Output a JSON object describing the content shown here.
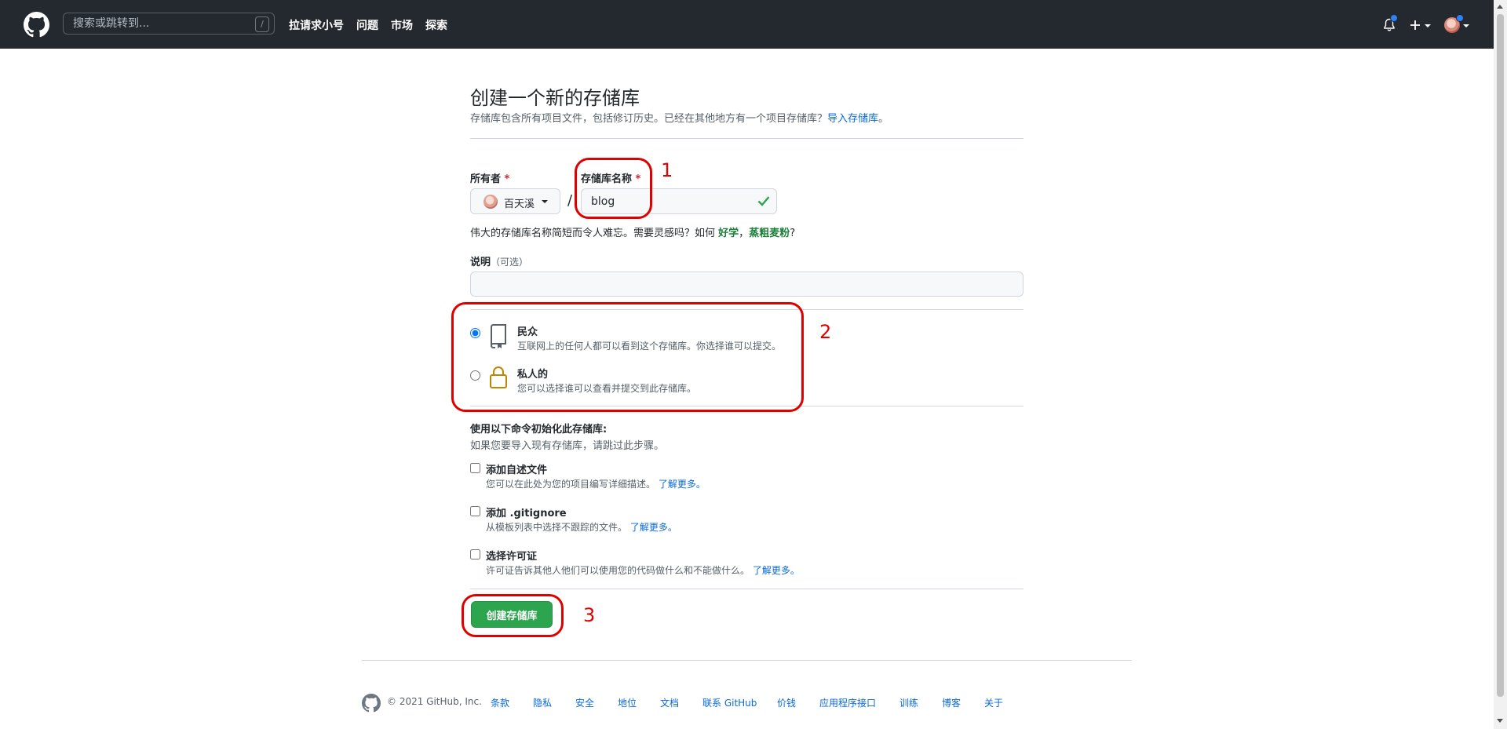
{
  "header": {
    "search_placeholder": "搜索或跳转到...",
    "search_shortcut": "/",
    "nav": [
      "拉请求小号",
      "问题",
      "市场",
      "探索"
    ],
    "icons": [
      "github-mark-icon",
      "bell-icon",
      "plus-icon",
      "avatar"
    ]
  },
  "page": {
    "title": "创建一个新的存储库",
    "subtitle": "存储库包含所有项目文件，包括修订历史。已经在其他地方有一个项目存储库？",
    "import_link": "导入存储库",
    "subtitle_end": "。"
  },
  "form": {
    "owner_label": "所有者",
    "required_mark": "*",
    "owner_value": "百天溪",
    "separator": "/",
    "repo_name_label": "存储库名称",
    "repo_name_value": "blog",
    "hint_prefix": "伟大的存储库名称简短而令人难忘。需要灵感吗？如何",
    "hint_suggestion1": "好学",
    "hint_comma": "，",
    "hint_suggestion2": "蒸粗麦粉",
    "hint_suffix": "?",
    "description_label": "说明",
    "description_optional": "（可选）",
    "description_value": ""
  },
  "visibility": {
    "public_title": "民众",
    "public_desc": "互联网上的任何人都可以看到这个存储库。你选择谁可以提交。",
    "public_selected": true,
    "private_title": "私人的",
    "private_desc": "您可以选择谁可以查看并提交到此存储库。"
  },
  "init": {
    "title": "使用以下命令初始化此存储库:",
    "subtitle": "如果您要导入现有存储库，请跳过此步骤。",
    "learn_more": "了解更多。",
    "options": [
      {
        "title": "添加自述文件",
        "desc": "您可以在此处为您的项目编写详细描述。",
        "checked": false
      },
      {
        "title": "添加 .gitignore",
        "desc": "从模板列表中选择不跟踪的文件。",
        "checked": false
      },
      {
        "title": "选择许可证",
        "desc": "许可证告诉其他人他们可以使用您的代码做什么和不能做什么。",
        "checked": false
      }
    ]
  },
  "submit": {
    "label": "创建存储库"
  },
  "annotations": {
    "step1": "1",
    "step2": "2",
    "step3": "3",
    "color": "#e00000"
  },
  "footer": {
    "copyright": "© 2021 GitHub, Inc.",
    "links": [
      "条款",
      "隐私",
      "安全",
      "地位",
      "文档",
      "联系 GitHub",
      "价钱",
      "应用程序接口",
      "训练",
      "博客",
      "关于"
    ]
  },
  "colors": {
    "header_bg": "#24292f",
    "primary_green": "#2da44e",
    "link_blue": "#0969da",
    "required_red": "#cf222e"
  }
}
